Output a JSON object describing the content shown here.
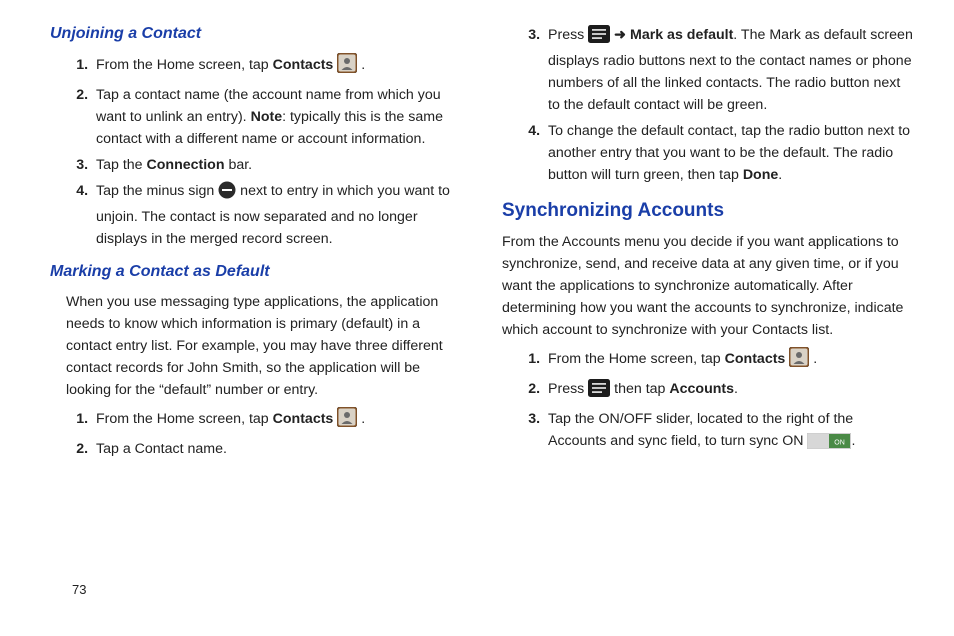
{
  "left": {
    "unjoin_heading": "Unjoining a Contact",
    "unjoin_steps": {
      "s1a": "From the Home screen, tap ",
      "s1b": "Contacts",
      "s1c": " .",
      "s2a": "Tap a contact name (the account name from which you want to unlink an entry). ",
      "s2b": "Note",
      "s2c": ": typically this is the same contact with a different name or account information.",
      "s3a": "Tap the ",
      "s3b": "Connection",
      "s3c": " bar.",
      "s4a": "Tap the minus sign ",
      "s4b": " next to entry in which you want to unjoin. The contact is now separated and no longer displays in the merged record screen."
    },
    "mark_heading": "Marking a Contact as Default",
    "mark_para": "When you use messaging type applications, the application needs to know which information is primary (default) in a contact entry list. For example, you may have three different contact records for John Smith, so the application will be looking for the “default” number or entry.",
    "mark_steps": {
      "s1a": "From the Home screen, tap ",
      "s1b": "Contacts",
      "s1c": " .",
      "s2": "Tap a Contact name."
    }
  },
  "right": {
    "cont_steps": {
      "s3a": "Press ",
      "s3arrow": " ➜ ",
      "s3b": "Mark as default",
      "s3c": ". The Mark as default screen displays radio buttons next to the contact names or phone numbers of all the linked contacts. The radio button next to the default contact will be green.",
      "s4a": "To change the default contact, tap the radio button next to another entry that you want to be the default. The radio button will turn green, then tap ",
      "s4b": "Done",
      "s4c": "."
    },
    "sync_heading": "Synchronizing Accounts",
    "sync_para": "From the Accounts menu you decide if you want applications to synchronize, send, and receive data at any given time, or if you want the applications to synchronize automatically. After determining how you want the accounts to synchronize, indicate which account to synchronize with your Contacts list.",
    "sync_steps": {
      "s1a": "From the Home screen, tap ",
      "s1b": "Contacts",
      "s1c": " .",
      "s2a": "Press ",
      "s2b": " then tap ",
      "s2c": "Accounts",
      "s2d": ".",
      "s3a": "Tap the ON/OFF slider, located to the right of the Accounts and sync field, to turn sync ON ",
      "s3b": "."
    }
  },
  "page_number": "73",
  "toggle_label": "ON"
}
